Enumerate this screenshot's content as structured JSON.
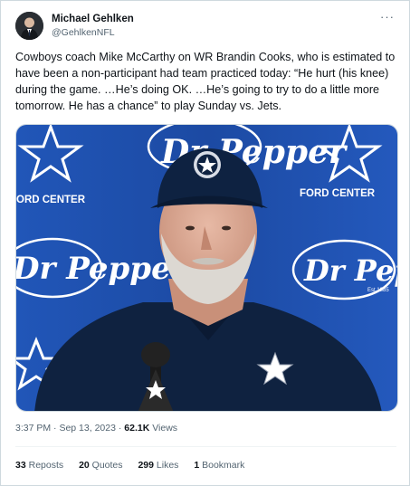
{
  "author": {
    "display_name": "Michael Gehlken",
    "handle": "@GehlkenNFL"
  },
  "menu_icon": "more-horizontal-icon",
  "tweet_text": "Cowboys coach Mike McCarthy on WR Brandin Cooks, who is estimated to have been a non-participant had team practiced today: “He hurt (his knee) during the game. …He’s doing OK. …He’s going to try to do a little more tomorrow. He has a chance” to play Sunday vs. Jets.",
  "media": {
    "backdrop_text_left": "ORD CENTER",
    "backdrop_text_right": "FORD CENTER",
    "sponsor_logo": "Dr Pepper",
    "sponsor_subtext": "Est.1885"
  },
  "meta": {
    "time": "3:37 PM",
    "separator": "·",
    "date": "Sep 13, 2023",
    "views_count": "62.1K",
    "views_label": "Views"
  },
  "stats": {
    "reposts_count": "33",
    "reposts_label": "Reposts",
    "quotes_count": "20",
    "quotes_label": "Quotes",
    "likes_count": "299",
    "likes_label": "Likes",
    "bookmarks_count": "1",
    "bookmarks_label": "Bookmark"
  },
  "colors": {
    "backdrop_blue": "#1f4fb0",
    "navy": "#0c1f3d",
    "text": "#0f1419",
    "muted": "#536471"
  }
}
